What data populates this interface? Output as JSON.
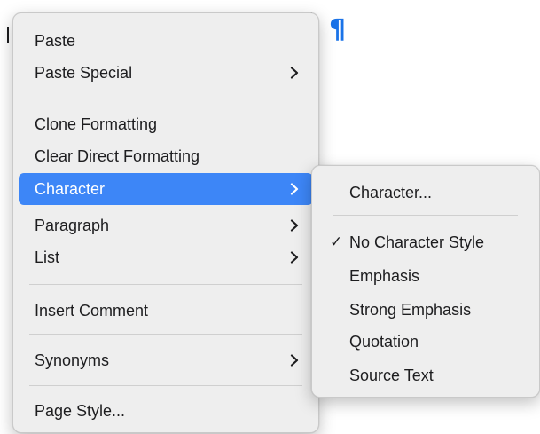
{
  "document": {
    "pilcrow": "¶"
  },
  "context_menu": {
    "items": [
      {
        "label": "Paste"
      },
      {
        "label": "Paste Special",
        "has_submenu": true
      },
      {
        "label": "Clone Formatting"
      },
      {
        "label": "Clear Direct Formatting"
      },
      {
        "label": "Character",
        "has_submenu": true,
        "selected": true
      },
      {
        "label": "Paragraph",
        "has_submenu": true
      },
      {
        "label": "List",
        "has_submenu": true
      },
      {
        "label": "Insert Comment"
      },
      {
        "label": "Synonyms",
        "has_submenu": true
      },
      {
        "label": "Page Style..."
      }
    ]
  },
  "character_submenu": {
    "items": [
      {
        "label": "Character..."
      },
      {
        "label": "No Character Style",
        "checked": true,
        "check_glyph": "✓"
      },
      {
        "label": "Emphasis"
      },
      {
        "label": "Strong Emphasis"
      },
      {
        "label": "Quotation"
      },
      {
        "label": "Source Text"
      }
    ]
  },
  "colors": {
    "selection": "#3d86f7",
    "pilcrow": "#1a73e8",
    "menu_background": "#eeeeee"
  }
}
